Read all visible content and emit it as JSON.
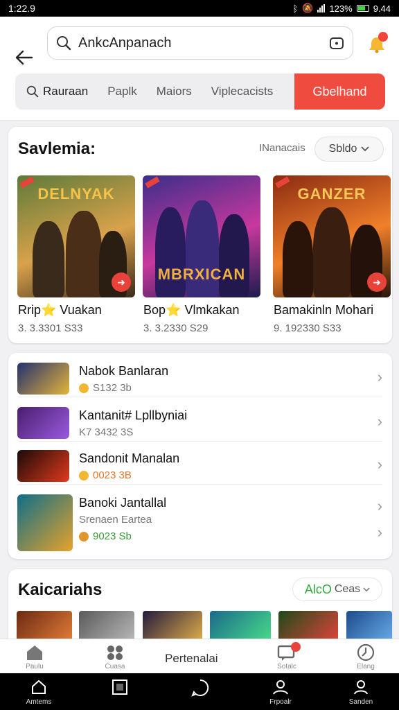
{
  "status_bar": {
    "time": "1:22.9",
    "battery_text": "123%",
    "clock_right": "9.44"
  },
  "header": {
    "search_value": "AnkcAnpanach",
    "filters": [
      "Rauraan",
      "Paplk",
      "Maiors",
      "Viplecacists"
    ],
    "cta_label": "Gbelhand"
  },
  "featured": {
    "title": "Savlemia:",
    "subtitle": "INanacais",
    "sort_label": "Sbldo",
    "games": [
      {
        "name": "Rrip⭐ Vuakan",
        "meta": "3. 3.3301 S33",
        "art_text": "DELNYAK",
        "colors": [
          "#5c7a3a",
          "#d9a24b",
          "#3a2a1c"
        ]
      },
      {
        "name": "Bop⭐ Vlmkakan",
        "meta": "3. 3.2330 S29",
        "art_text": "MBRXICAN",
        "colors": [
          "#3b2e8a",
          "#c8389e",
          "#1b1b4e"
        ]
      },
      {
        "name": "Bamakinln Mohari",
        "meta": "9. 192330 S33",
        "art_text": "GANZER",
        "colors": [
          "#8a2a12",
          "#f0802a",
          "#2a140a"
        ]
      }
    ]
  },
  "list": [
    {
      "name": "Nabok Banlaran",
      "meta": "S132 3b",
      "meta2": "",
      "colors": [
        "#22306e",
        "#e4b43a"
      ]
    },
    {
      "name": "Kantanit# Lpllbyniai",
      "meta": "K7 3432 3S",
      "meta2": "",
      "colors": [
        "#4a1e6e",
        "#9a5adf"
      ]
    },
    {
      "name": "Sandonit Manalan",
      "meta": "0023 3B",
      "meta2": "",
      "colors": [
        "#1a0a08",
        "#e03a1e"
      ]
    },
    {
      "name": "Banoki Jantallal",
      "meta": "Srenaen Eartea",
      "meta2": "9023 Sb",
      "colors": [
        "#0e6e8a",
        "#e6a22a"
      ]
    }
  ],
  "categories": {
    "title": "Kaicariahs",
    "pill_accent": "AlcO",
    "pill_label": "Ceas",
    "thumbs": [
      {
        "colors": [
          "#6a2a12",
          "#e8803a"
        ]
      },
      {
        "colors": [
          "#5a5a5a",
          "#bdbdbd"
        ]
      },
      {
        "colors": [
          "#241a3e",
          "#e6b44a"
        ]
      },
      {
        "colors": [
          "#1a6a8a",
          "#4adf8a"
        ]
      },
      {
        "colors": [
          "#1e4a1a",
          "#e8433a"
        ]
      },
      {
        "colors": [
          "#1e4a8a",
          "#6ab0ef"
        ]
      }
    ]
  },
  "tabbar": {
    "center_label": "Pertenalai",
    "tabs": [
      "Paulu",
      "Cuasa",
      "Sotalc",
      "Elang"
    ]
  },
  "navbar": [
    "Amtems",
    "",
    "",
    "Frpoalr",
    "Sanden"
  ]
}
